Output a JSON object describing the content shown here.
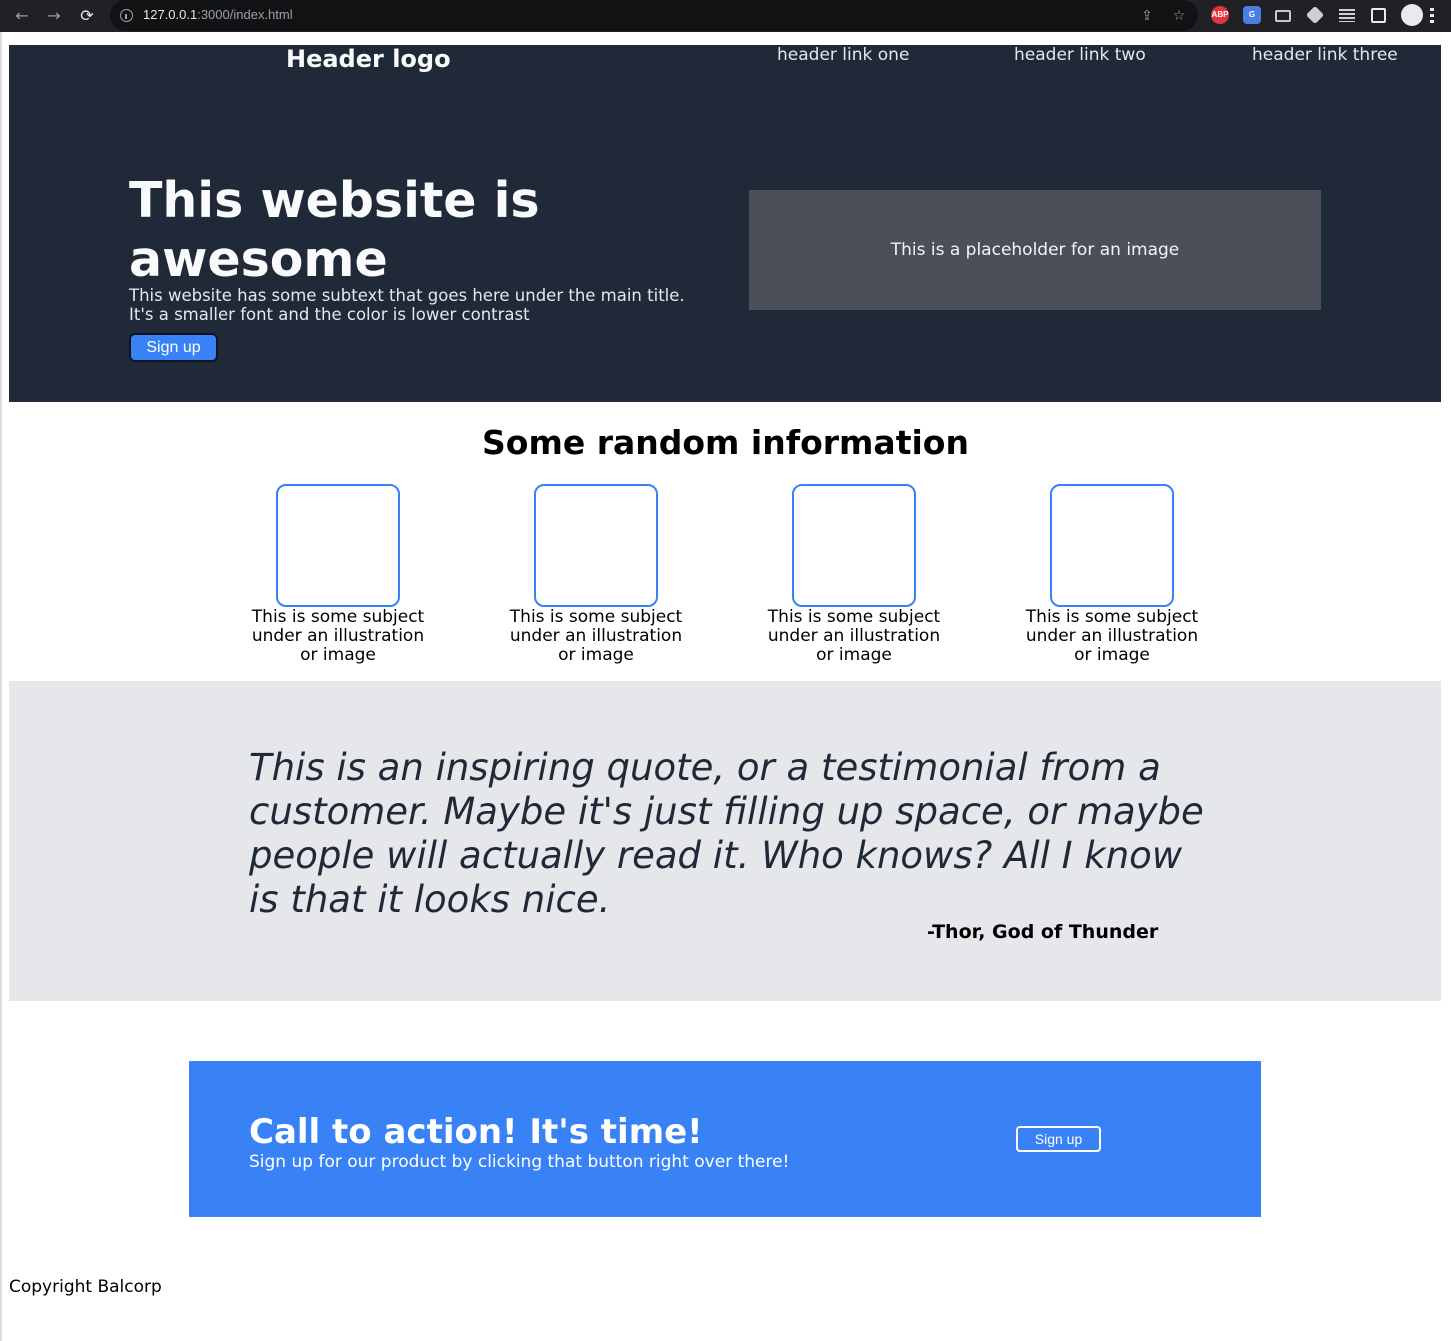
{
  "browser": {
    "url_host": "127.0.0.1",
    "url_rest": ":3000/index.html",
    "back_icon": "←",
    "forward_icon": "→",
    "reload_icon": "⟳",
    "share_icon": "⇪",
    "star_icon": "☆",
    "abp_label": "ABP",
    "translate_label": "G"
  },
  "header": {
    "logo": "Header logo",
    "links": [
      "header link one",
      "header link two",
      "header link three"
    ]
  },
  "hero": {
    "title": "This website is awesome",
    "subtext": "This website has some subtext that goes here under the main title. It's a smaller font and the color is lower contrast",
    "button": "Sign up",
    "image_placeholder": "This is a placeholder for an image"
  },
  "info": {
    "title": "Some random information",
    "cards": [
      "This is some subject under an illustration or image",
      "This is some subject under an illustration or image",
      "This is some subject under an illustration or image",
      "This is some subject under an illustration or image"
    ]
  },
  "quote": {
    "text": "This is an inspiring quote, or a testimonial from a customer. Maybe it's just filling up space, or maybe people will actually read it. Who knows? All I know is that it looks nice.",
    "author": "-Thor, God of Thunder"
  },
  "cta": {
    "title": "Call to action! It's time!",
    "subtext": "Sign up for our product by clicking that button right over there!",
    "button": "Sign up"
  },
  "footer": {
    "copyright": "Copyright Balcorp"
  },
  "colors": {
    "hero_bg": "#1f2937",
    "accent_blue": "#3882f6",
    "quote_bg": "#e5e7eb",
    "placeholder_bg": "#4a4f5a"
  }
}
